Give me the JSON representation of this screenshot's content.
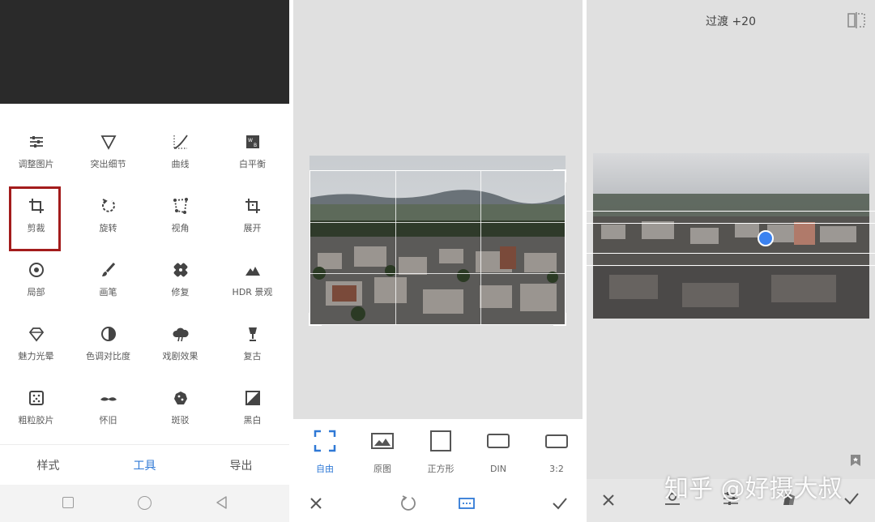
{
  "panel1": {
    "tools": [
      {
        "label": "调整图片",
        "icon": "tune-sliders-icon"
      },
      {
        "label": "突出细节",
        "icon": "details-triangle-icon"
      },
      {
        "label": "曲线",
        "icon": "curves-icon"
      },
      {
        "label": "白平衡",
        "icon": "white-balance-icon"
      },
      {
        "label": "剪裁",
        "icon": "crop-icon"
      },
      {
        "label": "旋转",
        "icon": "rotate-icon"
      },
      {
        "label": "视角",
        "icon": "perspective-icon"
      },
      {
        "label": "展开",
        "icon": "expand-icon"
      },
      {
        "label": "局部",
        "icon": "selective-icon"
      },
      {
        "label": "画笔",
        "icon": "brush-icon"
      },
      {
        "label": "修复",
        "icon": "healing-icon"
      },
      {
        "label": "HDR 景观",
        "icon": "hdr-mountain-icon"
      },
      {
        "label": "魅力光晕",
        "icon": "glamour-glow-icon"
      },
      {
        "label": "色调对比度",
        "icon": "tonal-contrast-icon"
      },
      {
        "label": "戏剧效果",
        "icon": "drama-cloud-icon"
      },
      {
        "label": "复古",
        "icon": "vintage-lamp-icon"
      },
      {
        "label": "粗粒胶片",
        "icon": "grainy-film-icon"
      },
      {
        "label": "怀旧",
        "icon": "retrolux-mustache-icon"
      },
      {
        "label": "斑驳",
        "icon": "grunge-icon"
      },
      {
        "label": "黑白",
        "icon": "black-white-icon"
      }
    ],
    "highlighted_tool": "剪裁",
    "tabs": {
      "styles": "样式",
      "tools": "工具",
      "export": "导出"
    },
    "active_tab": "工具"
  },
  "panel2": {
    "ratios": [
      {
        "label": "自由",
        "icon": "free-crop-icon"
      },
      {
        "label": "原图",
        "icon": "original-image-icon"
      },
      {
        "label": "正方形",
        "icon": "square-icon"
      },
      {
        "label": "DIN",
        "icon": "din-rect-icon"
      },
      {
        "label": "3:2",
        "icon": "ratio-3-2-icon"
      }
    ],
    "active_ratio": "自由"
  },
  "panel3": {
    "title": "过渡 +20",
    "watermark": "知乎 @好摄大叔"
  },
  "colors": {
    "accent": "#2f79d6",
    "highlight_border": "#a31c1c",
    "tilt_dot": "#3b82f0"
  }
}
